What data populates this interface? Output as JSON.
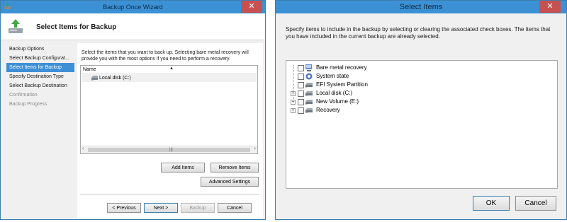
{
  "wizard": {
    "title": "Backup Once Wizard",
    "close_glyph": "✕",
    "header_title": "Select Items for Backup",
    "steps": [
      {
        "label": "Backup Options",
        "state": "normal"
      },
      {
        "label": "Select Backup Configurat...",
        "state": "normal"
      },
      {
        "label": "Select Items for Backup",
        "state": "active"
      },
      {
        "label": "Specify Destination Type",
        "state": "normal"
      },
      {
        "label": "Select Backup Destination",
        "state": "normal"
      },
      {
        "label": "Confirmation",
        "state": "disabled"
      },
      {
        "label": "Backup Progress",
        "state": "disabled"
      }
    ],
    "description": "Select the items that you want to back up. Selecting bare metal recovery will provide you with the most options if you need to perform a recovery.",
    "list": {
      "column_header": "Name",
      "sort_glyph": "▲",
      "items": [
        {
          "label": "Local disk (C:)"
        }
      ],
      "scroll_left_glyph": "‹",
      "scroll_right_glyph": "›",
      "thumb_grip": "|||"
    },
    "buttons": {
      "add_items": "Add Items",
      "remove_items": "Remove Items",
      "advanced_settings": "Advanced Settings",
      "previous": "< Previous",
      "next": "Next >",
      "backup": "Backup",
      "cancel": "Cancel"
    }
  },
  "select_items": {
    "title": "Select Items",
    "close_glyph": "✕",
    "description": "Specify items to include in the backup by selecting or clearing the associated check boxes. The items that you have included in the current backup are already selected.",
    "tree": [
      {
        "label": "Bare metal recovery",
        "icon": "bare-metal-recovery-icon",
        "expandable": false,
        "checked": false
      },
      {
        "label": "System state",
        "icon": "system-state-icon",
        "expandable": false,
        "checked": false
      },
      {
        "label": "EFI System Partition",
        "icon": "drive-icon",
        "expandable": false,
        "checked": false
      },
      {
        "label": "Local disk (C:)",
        "icon": "drive-icon",
        "expandable": true,
        "checked": false
      },
      {
        "label": "New Volume (E:)",
        "icon": "drive-icon",
        "expandable": true,
        "checked": false
      },
      {
        "label": "Recovery",
        "icon": "drive-icon",
        "expandable": true,
        "checked": false
      }
    ],
    "expander_glyph": "+",
    "buttons": {
      "ok": "OK",
      "cancel": "Cancel"
    }
  },
  "colors": {
    "titlebar": "#3c91d4",
    "close": "#c75050",
    "active_step": "#3f8fd7"
  }
}
